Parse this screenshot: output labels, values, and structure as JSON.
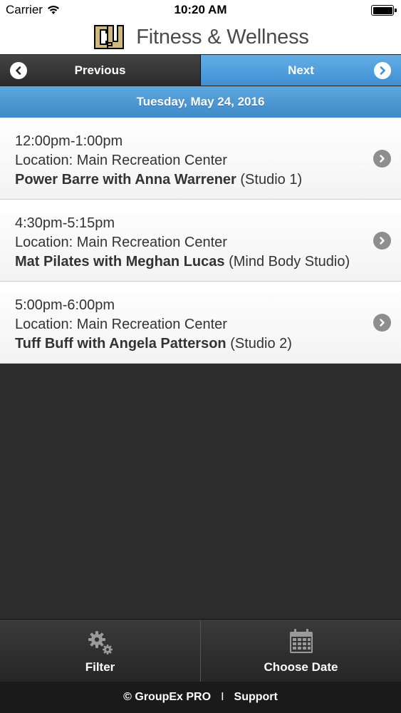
{
  "status_bar": {
    "carrier": "Carrier",
    "time": "10:20 AM",
    "icons": [
      "wifi-icon",
      "battery-icon"
    ]
  },
  "header": {
    "title": "Fitness & Wellness",
    "logo_colors": {
      "gold": "#CFB87C",
      "black": "#000000"
    }
  },
  "nav": {
    "previous_label": "Previous",
    "next_label": "Next",
    "active_color": "#4A9AD9"
  },
  "date_label": "Tuesday, May 24, 2016",
  "classes": [
    {
      "time": "12:00pm-1:00pm",
      "location": "Location: Main Recreation Center",
      "name": "Power Barre with Anna Warrener",
      "room": "(Studio 1)"
    },
    {
      "time": "4:30pm-5:15pm",
      "location": "Location: Main Recreation Center",
      "name": "Mat Pilates with Meghan Lucas",
      "room": "(Mind Body Studio)"
    },
    {
      "time": "5:00pm-6:00pm",
      "location": "Location: Main Recreation Center",
      "name": "Tuff Buff with Angela Patterson",
      "room": "(Studio 2)"
    }
  ],
  "bottom_tabs": {
    "filter_label": "Filter",
    "choose_date_label": "Choose Date"
  },
  "footer": {
    "brand": "© GroupEx PRO",
    "separator": "I",
    "support": "Support"
  }
}
